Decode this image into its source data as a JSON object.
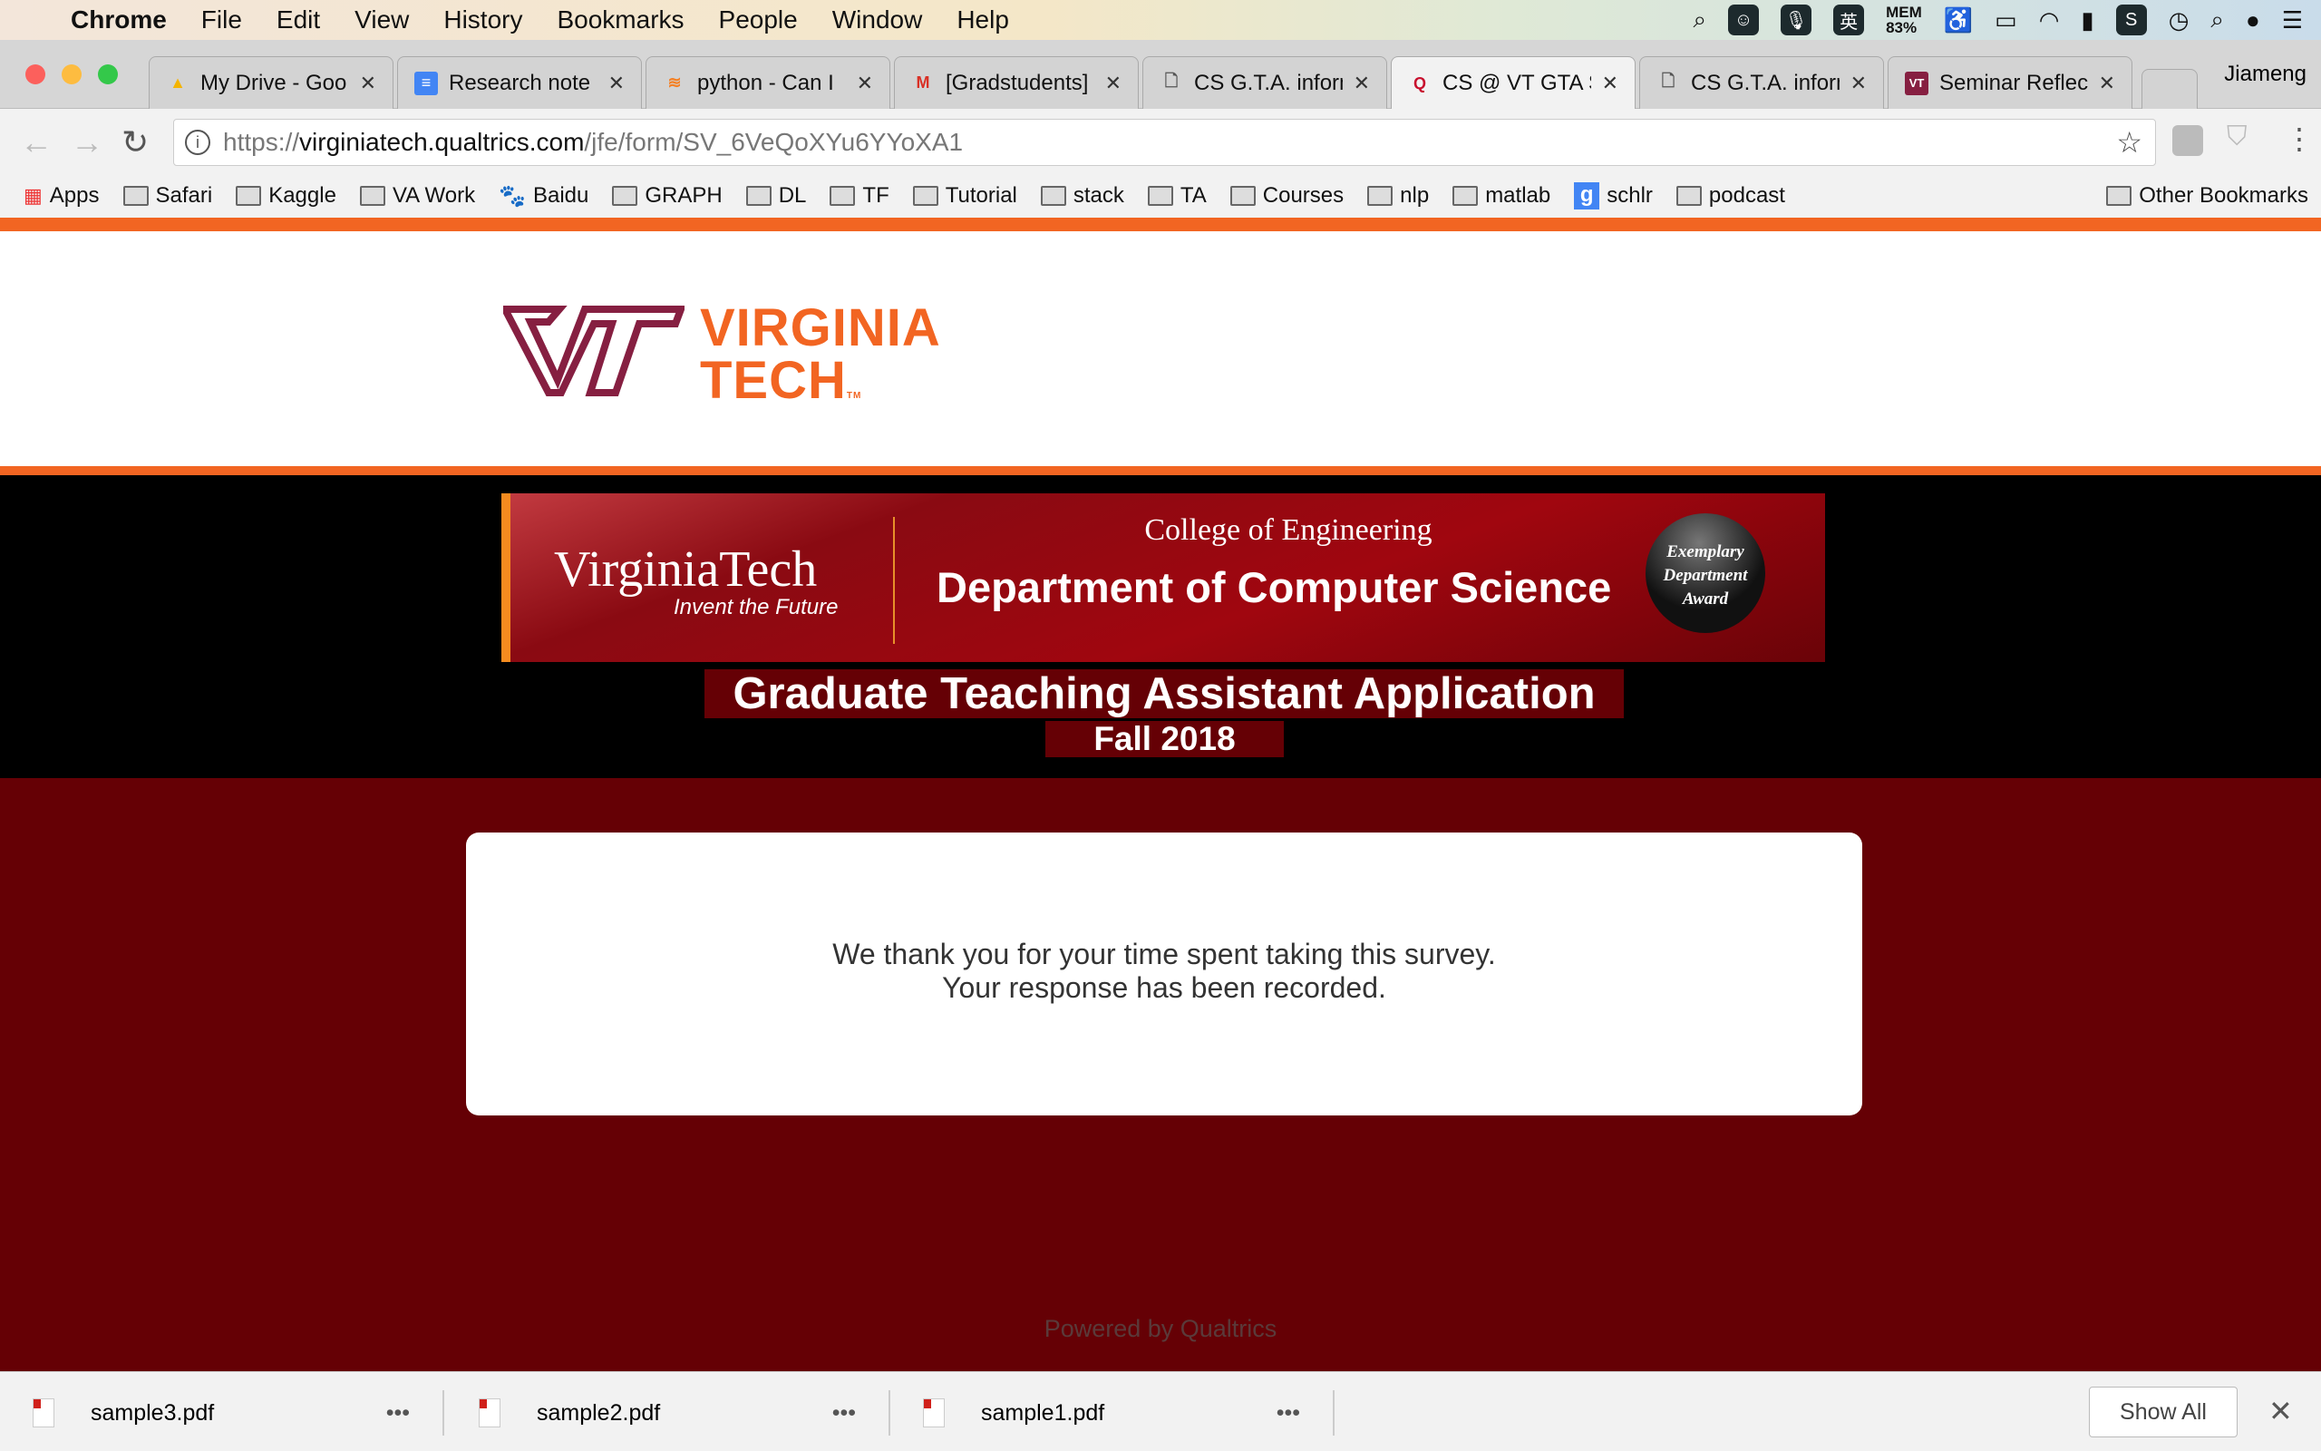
{
  "menubar": {
    "app": "Chrome",
    "items": [
      "File",
      "Edit",
      "View",
      "History",
      "Bookmarks",
      "People",
      "Window",
      "Help"
    ],
    "mem_label": "MEM",
    "mem_value": "83%"
  },
  "tabs": [
    {
      "title": "My Drive - Goo",
      "icon": "google-drive-icon"
    },
    {
      "title": "Research note",
      "icon": "google-docs-icon"
    },
    {
      "title": "python - Can I",
      "icon": "stackoverflow-icon"
    },
    {
      "title": "[Gradstudents]",
      "icon": "gmail-icon"
    },
    {
      "title": "CS G.T.A. inform",
      "icon": "page-icon"
    },
    {
      "title": "CS @ VT GTA S",
      "icon": "qualtrics-icon",
      "active": true
    },
    {
      "title": "CS G.T.A. inform",
      "icon": "page-icon"
    },
    {
      "title": "Seminar Reflec",
      "icon": "vt-icon"
    }
  ],
  "profile": "Jiameng",
  "url": {
    "scheme": "https://",
    "host": "virginiatech.qualtrics.com",
    "path": "/jfe/form/SV_6VeQoXYu6YYoXA1"
  },
  "bookmarks": [
    "Apps",
    "Safari",
    "Kaggle",
    "VA Work",
    "Baidu",
    "GRAPH",
    "DL",
    "TF",
    "Tutorial",
    "stack",
    "TA",
    "Courses",
    "nlp",
    "matlab",
    "schlr",
    "podcast"
  ],
  "other_bookmarks": "Other Bookmarks",
  "logo": {
    "line1": "VIRGINIA",
    "line2": "TECH",
    "tm": "TM"
  },
  "banner": {
    "vt": "VirginiaTech",
    "tagline": "Invent the Future",
    "college": "College of Engineering",
    "dept": "Department of Computer Science",
    "award": [
      "Exemplary",
      "Department",
      "Award"
    ]
  },
  "title": "Graduate Teaching Assistant Application",
  "term": "Fall 2018",
  "message": [
    "We thank you for your time spent taking this survey.",
    "Your response has been recorded."
  ],
  "powered": "Powered by Qualtrics",
  "downloads": [
    "sample3.pdf",
    "sample2.pdf",
    "sample1.pdf"
  ],
  "show_all": "Show All",
  "colors": {
    "orange": "#f26522",
    "maroon": "#650005"
  }
}
